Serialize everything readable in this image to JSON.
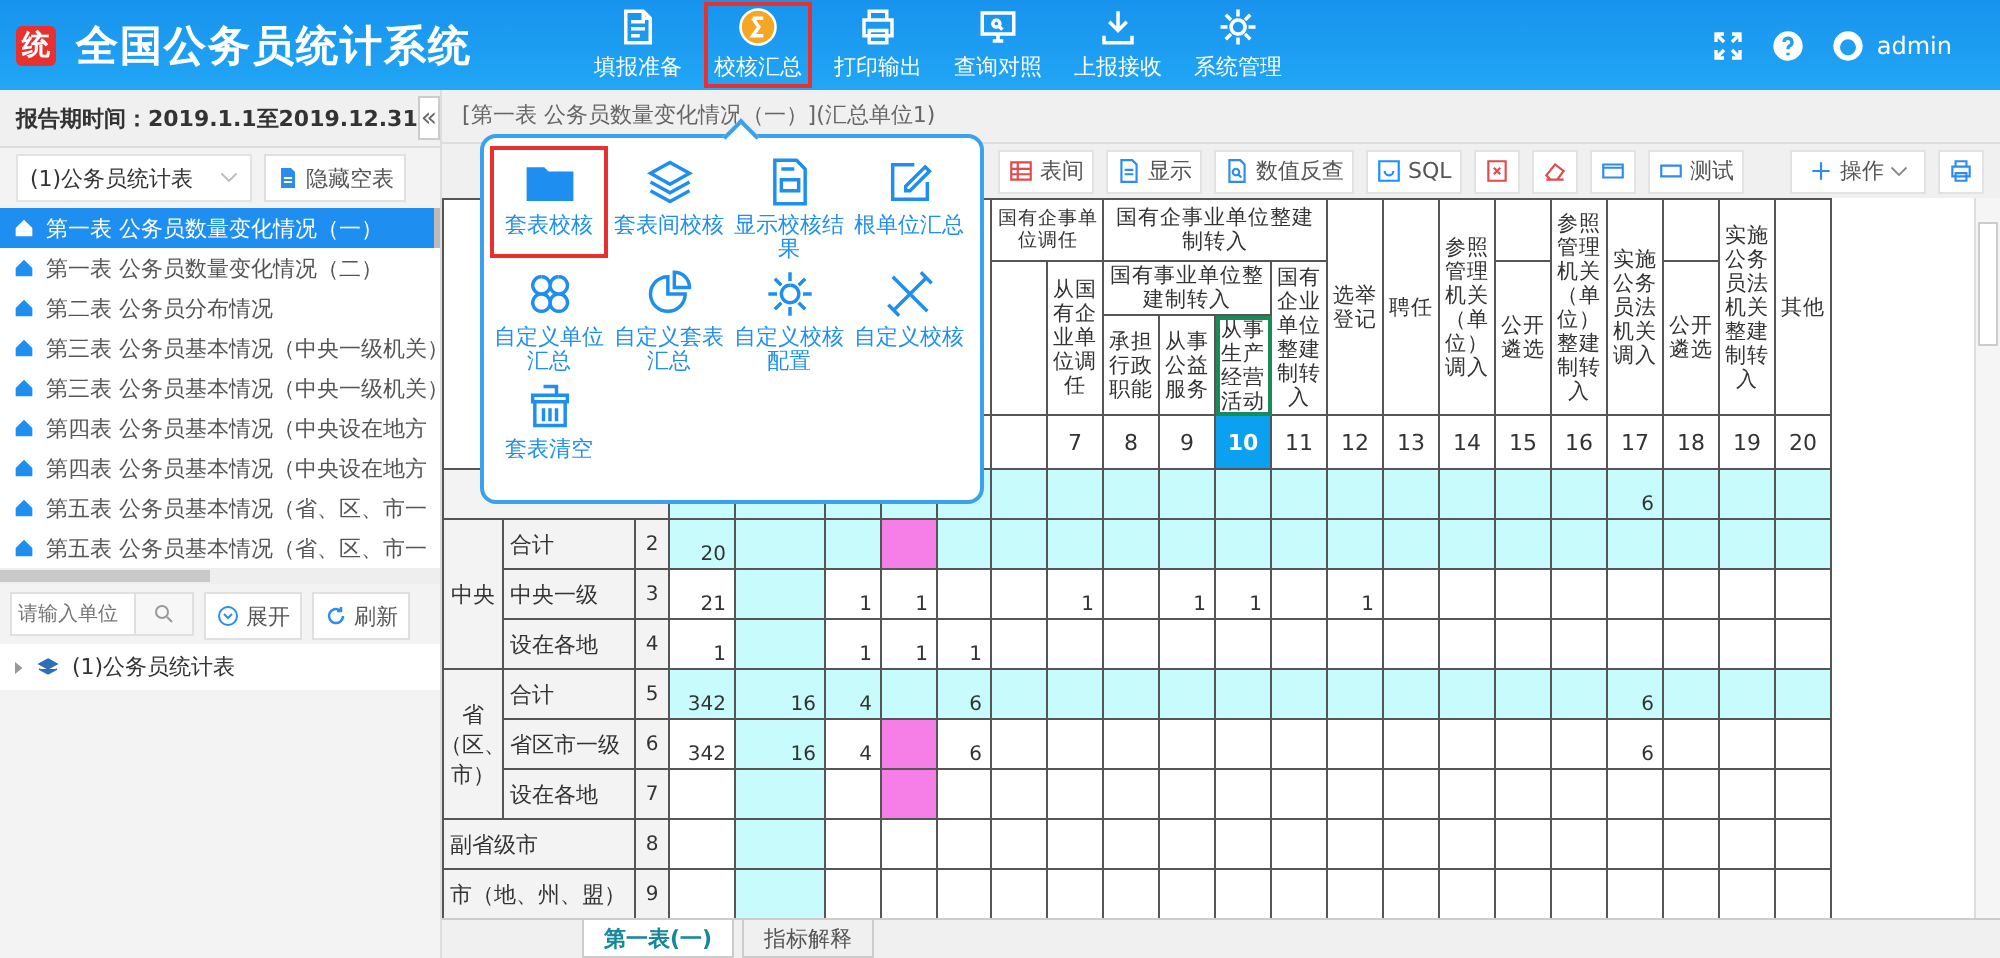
{
  "header": {
    "logo": "统",
    "title": "全国公务员统计系统",
    "nav": [
      {
        "label": "填报准备",
        "selected": false
      },
      {
        "label": "校核汇总",
        "selected": true
      },
      {
        "label": "打印输出",
        "selected": false
      },
      {
        "label": "查询对照",
        "selected": false
      },
      {
        "label": "上报接收",
        "selected": false
      },
      {
        "label": "系统管理",
        "selected": false
      }
    ],
    "user": "admin"
  },
  "period": {
    "text": "报告期时间：2019.1.1至2019.12.31",
    "collapse": "«"
  },
  "breadcrumb": "[第一表 公务员数量变化情况（一）](汇总单位1)",
  "sidebar": {
    "dropdown": "(1)公务员统计表",
    "hide_button": "隐藏空表",
    "tables": [
      {
        "label": "第一表 公务员数量变化情况（一）",
        "selected": true
      },
      {
        "label": "第一表 公务员数量变化情况（二）",
        "selected": false
      },
      {
        "label": "第二表 公务员分布情况",
        "selected": false
      },
      {
        "label": "第三表 公务员基本情况（中央一级机关）",
        "selected": false
      },
      {
        "label": "第三表 公务员基本情况（中央一级机关）",
        "selected": false
      },
      {
        "label": "第四表 公务员基本情况（中央设在地方",
        "selected": false
      },
      {
        "label": "第四表 公务员基本情况（中央设在地方",
        "selected": false
      },
      {
        "label": "第五表 公务员基本情况（省、区、市一",
        "selected": false
      },
      {
        "label": "第五表 公务员基本情况（省、区、市一",
        "selected": false
      }
    ],
    "search": {
      "placeholder": "请输入单位"
    },
    "expand_button": "展开",
    "refresh_button": "刷新",
    "tree": [
      {
        "label": "(1)公务员统计表",
        "expanded": false
      }
    ]
  },
  "toolbar": [
    {
      "kind": "text",
      "label": "表间"
    },
    {
      "kind": "text",
      "label": "显示"
    },
    {
      "kind": "text",
      "label": "数值反查"
    },
    {
      "kind": "text",
      "label": "SQL"
    },
    {
      "kind": "icon"
    },
    {
      "kind": "icon"
    },
    {
      "kind": "icon"
    },
    {
      "kind": "text",
      "label": "测试"
    },
    {
      "kind": "menu",
      "label": "操作"
    },
    {
      "kind": "icon"
    }
  ],
  "popup": {
    "items": [
      {
        "label": "套表校核",
        "selected": true
      },
      {
        "label": "套表间校核",
        "selected": false
      },
      {
        "label": "显示校核结果",
        "selected": false
      },
      {
        "label": "根单位汇总",
        "selected": false
      },
      {
        "label": "自定义单位汇总",
        "selected": false
      },
      {
        "label": "自定义套表汇总",
        "selected": false
      },
      {
        "label": "自定义校核配置",
        "selected": false
      },
      {
        "label": "自定义校核",
        "selected": false
      },
      {
        "label": "套表清空",
        "selected": false
      }
    ]
  },
  "table": {
    "header": [
      {
        "label": "国有企事单位调任",
        "selected": false
      },
      {
        "label": "从国有企业单位调任",
        "selected": false
      },
      {
        "label": "国有企事业单位整建制转入",
        "selected": false
      },
      {
        "label": "国有事业单位整建制转入",
        "selected": false
      },
      {
        "label": "承担行政职能",
        "selected": false
      },
      {
        "label": "从事公益服务",
        "selected": false
      },
      {
        "label": "从事生产经营活动",
        "selected": true
      },
      {
        "label": "国有企业单位整建制转入",
        "selected": false
      },
      {
        "label": "选举登记",
        "selected": false
      },
      {
        "label": "聘任",
        "selected": false
      },
      {
        "label": "参照管理机关（单位）调入",
        "selected": false
      },
      {
        "label": "公开遴选",
        "selected": false
      },
      {
        "label": "参照管理机关（单位）整建制转入",
        "selected": false
      },
      {
        "label": "实施公务员法机关调入",
        "selected": false
      },
      {
        "label": "公开遴选",
        "selected": false
      },
      {
        "label": "实施公务员法机关整建制转入",
        "selected": false
      },
      {
        "label": "其他",
        "selected": false
      }
    ],
    "columns": [
      {
        "highlighted": false
      },
      {
        "highlighted": true
      },
      {
        "highlighted": false
      },
      {
        "highlighted": false
      },
      {
        "highlighted": false
      },
      {
        "highlighted": false
      },
      {
        "number": "7",
        "highlighted": false,
        "selected": false
      },
      {
        "number": "8",
        "highlighted": false,
        "selected": false
      },
      {
        "number": "9",
        "highlighted": false,
        "selected": false
      },
      {
        "number": "10",
        "highlighted": false,
        "selected": true
      },
      {
        "number": "11",
        "highlighted": false,
        "selected": false
      },
      {
        "number": "12",
        "highlighted": false,
        "selected": false
      },
      {
        "number": "13",
        "highlighted": false,
        "selected": false
      },
      {
        "number": "14",
        "highlighted": false,
        "selected": false
      },
      {
        "number": "15",
        "highlighted": false,
        "selected": false
      },
      {
        "number": "16",
        "highlighted": false,
        "selected": false
      },
      {
        "number": "17",
        "highlighted": false,
        "selected": false
      },
      {
        "number": "18",
        "highlighted": false,
        "selected": false
      },
      {
        "number": "19",
        "highlighted": false,
        "selected": false
      },
      {
        "number": "20",
        "highlighted": false,
        "selected": false
      }
    ],
    "sections": [
      {
        "kind": "plain",
        "rows": [
          {
            "highlighted": true,
            "cells": [
              "",
              "",
              "",
              "",
              "",
              "",
              "",
              "",
              "",
              "",
              "",
              "",
              "",
              "",
              "",
              "",
              "6",
              "",
              "",
              ""
            ],
            "marked": [
              false,
              false,
              false,
              false,
              false,
              false,
              false,
              false,
              false,
              false,
              false,
              false,
              false,
              false,
              false,
              false,
              false,
              false,
              false,
              false
            ]
          }
        ]
      },
      {
        "kind": "group",
        "group": "中央",
        "rows": [
          {
            "label": "合计",
            "number": "2",
            "highlighted": true,
            "cells": [
              "20",
              "",
              "",
              "",
              "",
              "",
              "",
              "",
              "",
              "",
              "",
              "",
              "",
              "",
              "",
              "",
              "",
              "",
              "",
              ""
            ],
            "marked": [
              false,
              false,
              false,
              true,
              false,
              false,
              false,
              false,
              false,
              false,
              false,
              false,
              false,
              false,
              false,
              false,
              false,
              false,
              false,
              false
            ]
          },
          {
            "label": "中央一级",
            "number": "3",
            "highlighted": false,
            "cells": [
              "21",
              "",
              "1",
              "1",
              "",
              "",
              "1",
              "",
              "1",
              "1",
              "",
              "1",
              "",
              "",
              "",
              "",
              "",
              "",
              "",
              ""
            ],
            "marked": [
              false,
              false,
              false,
              false,
              false,
              false,
              false,
              false,
              false,
              false,
              false,
              false,
              false,
              false,
              false,
              false,
              false,
              false,
              false,
              false
            ]
          },
          {
            "label": "设在各地",
            "number": "4",
            "highlighted": false,
            "cells": [
              "1",
              "",
              "1",
              "1",
              "1",
              "",
              "",
              "",
              "",
              "",
              "",
              "",
              "",
              "",
              "",
              "",
              "",
              "",
              "",
              ""
            ],
            "marked": [
              false,
              false,
              false,
              false,
              false,
              false,
              false,
              false,
              false,
              false,
              false,
              false,
              false,
              false,
              false,
              false,
              false,
              false,
              false,
              false
            ]
          }
        ]
      },
      {
        "kind": "group",
        "group": "省（区、市）",
        "rows": [
          {
            "label": "合计",
            "number": "5",
            "highlighted": true,
            "cells": [
              "342",
              "16",
              "4",
              "",
              "6",
              "",
              "",
              "",
              "",
              "",
              "",
              "",
              "",
              "",
              "",
              "",
              "6",
              "",
              "",
              ""
            ],
            "marked": [
              false,
              false,
              false,
              false,
              false,
              false,
              false,
              false,
              false,
              false,
              false,
              false,
              false,
              false,
              false,
              false,
              false,
              false,
              false,
              false
            ]
          },
          {
            "label": "省区市一级",
            "number": "6",
            "highlighted": false,
            "cells": [
              "342",
              "16",
              "4",
              "",
              "6",
              "",
              "",
              "",
              "",
              "",
              "",
              "",
              "",
              "",
              "",
              "",
              "6",
              "",
              "",
              ""
            ],
            "marked": [
              false,
              false,
              false,
              true,
              false,
              false,
              false,
              false,
              false,
              false,
              false,
              false,
              false,
              false,
              false,
              false,
              false,
              false,
              false,
              false
            ]
          },
          {
            "label": "设在各地",
            "number": "7",
            "highlighted": false,
            "cells": [
              "",
              "",
              "",
              "",
              "",
              "",
              "",
              "",
              "",
              "",
              "",
              "",
              "",
              "",
              "",
              "",
              "",
              "",
              "",
              ""
            ],
            "marked": [
              false,
              false,
              false,
              true,
              false,
              false,
              false,
              false,
              false,
              false,
              false,
              false,
              false,
              false,
              false,
              false,
              false,
              false,
              false,
              false
            ]
          }
        ]
      },
      {
        "kind": "wide",
        "rows": [
          {
            "label": "副省级市",
            "number": "8",
            "highlighted": false,
            "cells": [
              "",
              "",
              "",
              "",
              "",
              "",
              "",
              "",
              "",
              "",
              "",
              "",
              "",
              "",
              "",
              "",
              "",
              "",
              "",
              ""
            ],
            "marked": [
              false,
              false,
              false,
              false,
              false,
              false,
              false,
              false,
              false,
              false,
              false,
              false,
              false,
              false,
              false,
              false,
              false,
              false,
              false,
              false
            ]
          },
          {
            "label": "市（地、州、盟）",
            "number": "9",
            "highlighted": false,
            "cells": [
              "",
              "",
              "",
              "",
              "",
              "",
              "",
              "",
              "",
              "",
              "",
              "",
              "",
              "",
              "",
              "",
              "",
              "",
              "",
              ""
            ],
            "marked": [
              false,
              false,
              false,
              false,
              false,
              false,
              false,
              false,
              false,
              false,
              false,
              false,
              false,
              false,
              false,
              false,
              false,
              false,
              false,
              false
            ]
          }
        ]
      }
    ]
  },
  "sheet_tabs": [
    {
      "label": "第一表(一)",
      "selected": true
    },
    {
      "label": "指标解释",
      "selected": false
    }
  ]
}
